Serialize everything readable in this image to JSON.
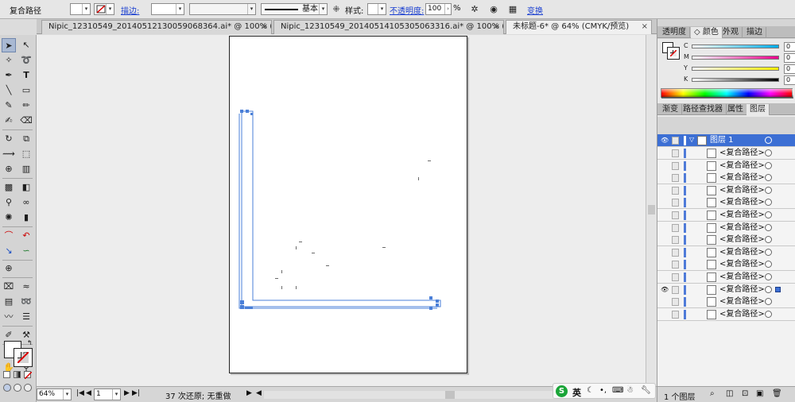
{
  "control_bar": {
    "object_type": "复合路径",
    "stroke_label": "描边:",
    "stroke_style": "基本",
    "style_label": "样式:",
    "opacity_label": "不透明度:",
    "opacity_value": "100",
    "opacity_unit": "%",
    "transform_label": "变换"
  },
  "doc_tabs": [
    {
      "label": "Nipic_12310549_20140512130059068364.ai* @ 100% (R...",
      "close": "×"
    },
    {
      "label": "Nipic_12310549_20140514105305063316.ai* @ 100% (R...",
      "close": "×"
    },
    {
      "label": "未标题-6* @ 64% (CMYK/预览)",
      "close": "×"
    }
  ],
  "status_bar": {
    "zoom": "64%",
    "page": "1",
    "history": "37 次还原; 无重做"
  },
  "color_panel": {
    "tabs": [
      "透明度",
      "颜色",
      "外观",
      "描边"
    ],
    "active_tab": "颜色",
    "channels": [
      {
        "label": "C",
        "value": "0",
        "unit": "%",
        "color": "#00aeef"
      },
      {
        "label": "M",
        "value": "0",
        "unit": "%",
        "color": "#ec008c"
      },
      {
        "label": "Y",
        "value": "0",
        "unit": "%",
        "color": "#fff200"
      },
      {
        "label": "K",
        "value": "0",
        "unit": "%",
        "color": "#000000"
      }
    ]
  },
  "layers_panel": {
    "tabs": [
      "渐变",
      "路径查找器",
      "属性",
      "图层"
    ],
    "active_tab": "图层",
    "layer_name": "图层 1",
    "item_name": "<复合路径>",
    "item_count": 14,
    "visible_item_index": 12,
    "footer_label": "1 个图层"
  },
  "colors": {
    "path_stroke": "#4a7fd8",
    "selection_accent": "#3c6fd4"
  },
  "ime": {
    "lang": "英"
  }
}
